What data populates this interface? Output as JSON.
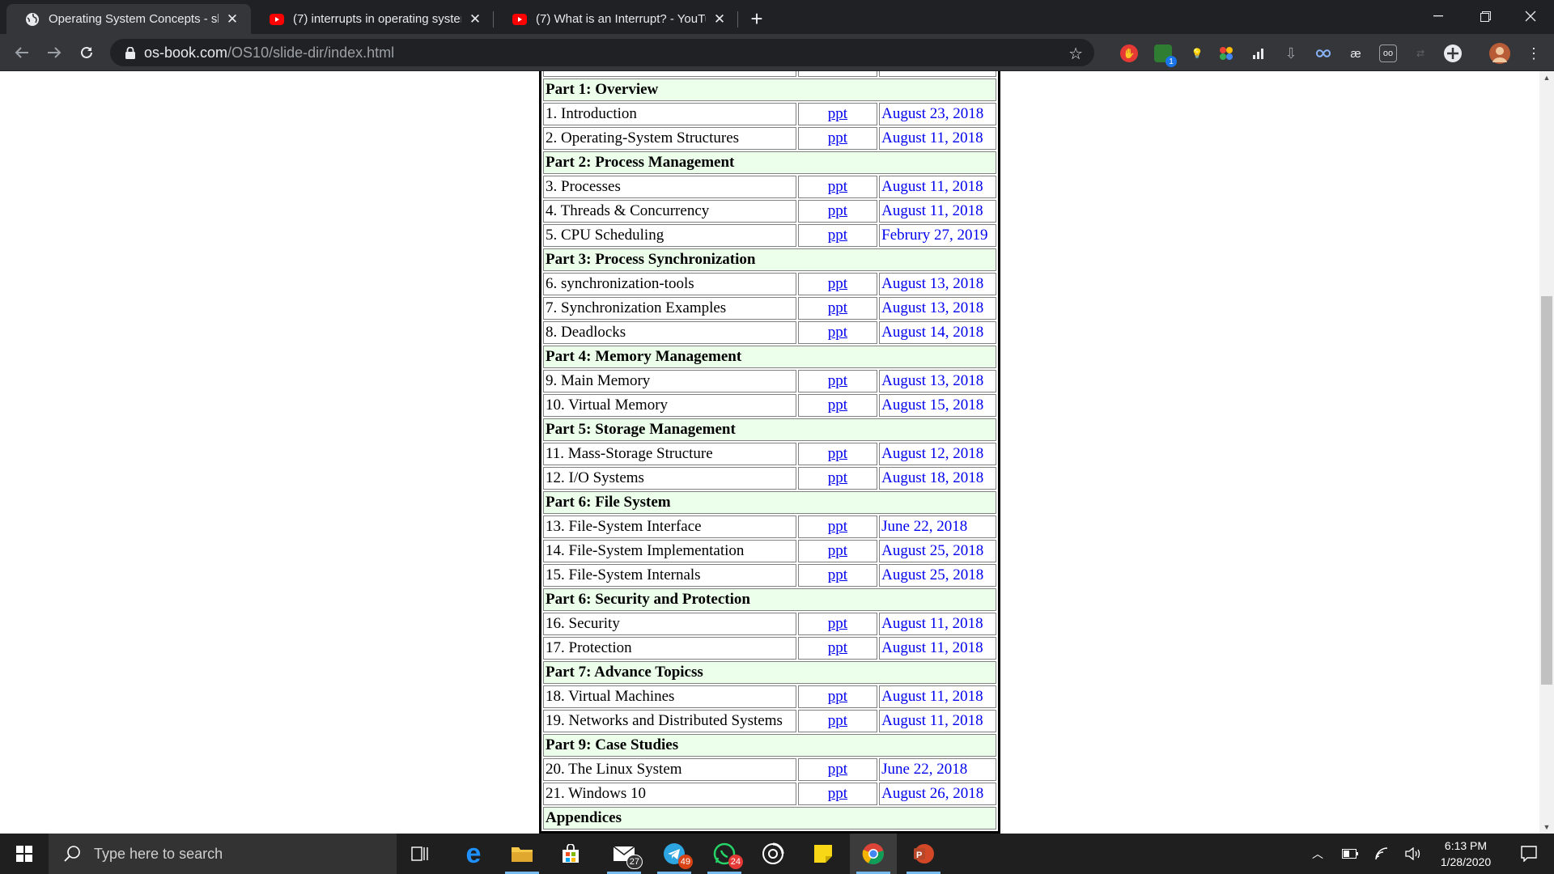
{
  "browser": {
    "tabs": [
      {
        "title": "Operating System Concepts - slid",
        "active": true,
        "favicon": "globe-icon"
      },
      {
        "title": "(7) interrupts in operating system",
        "active": false,
        "favicon": "youtube-icon"
      },
      {
        "title": "(7) What is an Interrupt? - YouTub",
        "active": false,
        "favicon": "youtube-icon"
      }
    ],
    "url_host": "os-book.com",
    "url_path": "/OS10/slide-dir/index.html",
    "extension_badge": "1"
  },
  "table": {
    "rows": [
      {
        "type": "part",
        "title": "Part 1: Overview"
      },
      {
        "type": "chapter",
        "name": "1. Introduction",
        "link": "ppt",
        "date": "August 23, 2018"
      },
      {
        "type": "chapter",
        "name": "2. Operating-System Structures",
        "link": "ppt",
        "date": "August 11, 2018"
      },
      {
        "type": "part",
        "title": "Part 2: Process Management"
      },
      {
        "type": "chapter",
        "name": "3. Processes",
        "link": "ppt",
        "date": "August 11, 2018"
      },
      {
        "type": "chapter",
        "name": "4. Threads & Concurrency",
        "link": "ppt",
        "date": "August 11, 2018"
      },
      {
        "type": "chapter",
        "name": "5. CPU Scheduling",
        "link": "ppt",
        "date": "Februry 27, 2019"
      },
      {
        "type": "part",
        "title": "Part 3: Process Synchronization"
      },
      {
        "type": "chapter",
        "name": "6. synchronization-tools",
        "link": "ppt",
        "date": "August 13, 2018"
      },
      {
        "type": "chapter",
        "name": "7. Synchronization Examples",
        "link": "ppt",
        "date": "August 13, 2018"
      },
      {
        "type": "chapter",
        "name": "8. Deadlocks",
        "link": "ppt",
        "date": "August 14, 2018"
      },
      {
        "type": "part",
        "title": "Part 4: Memory Management"
      },
      {
        "type": "chapter",
        "name": "9. Main Memory",
        "link": "ppt",
        "date": "August 13, 2018"
      },
      {
        "type": "chapter",
        "name": "10. Virtual Memory",
        "link": "ppt",
        "date": "August 15, 2018"
      },
      {
        "type": "part",
        "title": "Part 5: Storage Management"
      },
      {
        "type": "chapter",
        "name": "11. Mass-Storage Structure",
        "link": "ppt",
        "date": "August 12, 2018"
      },
      {
        "type": "chapter",
        "name": "12. I/O Systems",
        "link": "ppt",
        "date": "August 18, 2018"
      },
      {
        "type": "part",
        "title": "Part 6: File System"
      },
      {
        "type": "chapter",
        "name": "13. File-System Interface",
        "link": "ppt",
        "date": "June 22, 2018"
      },
      {
        "type": "chapter",
        "name": "14. File-System Implementation",
        "link": "ppt",
        "date": "August 25, 2018"
      },
      {
        "type": "chapter",
        "name": "15. File-System Internals",
        "link": "ppt",
        "date": "August 25, 2018"
      },
      {
        "type": "part",
        "title": "Part 6: Security and Protection"
      },
      {
        "type": "chapter",
        "name": "16. Security",
        "link": "ppt",
        "date": "August 11, 2018"
      },
      {
        "type": "chapter",
        "name": "17. Protection",
        "link": "ppt",
        "date": "August 11, 2018"
      },
      {
        "type": "part",
        "title": "Part 7: Advance Topicss"
      },
      {
        "type": "chapter",
        "name": "18. Virtual Machines",
        "link": "ppt",
        "date": "August 11, 2018"
      },
      {
        "type": "chapter",
        "name": "19. Networks and Distributed Systems",
        "link": "ppt",
        "date": "August 11, 2018"
      },
      {
        "type": "part",
        "title": "Part 9: Case Studies"
      },
      {
        "type": "chapter",
        "name": "20. The Linux System",
        "link": "ppt",
        "date": "June 22, 2018"
      },
      {
        "type": "chapter",
        "name": "21. Windows 10",
        "link": "ppt",
        "date": "August 26, 2018"
      },
      {
        "type": "part",
        "title": "Appendices"
      }
    ]
  },
  "taskbar": {
    "search_placeholder": "Type here to search",
    "badges": {
      "mail": "27",
      "telegram": "49",
      "whatsapp": "24"
    },
    "time": "6:13 PM",
    "date": "1/28/2020"
  },
  "colors": {
    "tab_strip": "#202124",
    "toolbar": "#35363a",
    "part_row_bg": "#ebffeb",
    "link": "#0000ee",
    "taskbar": "#1f1f1f"
  }
}
